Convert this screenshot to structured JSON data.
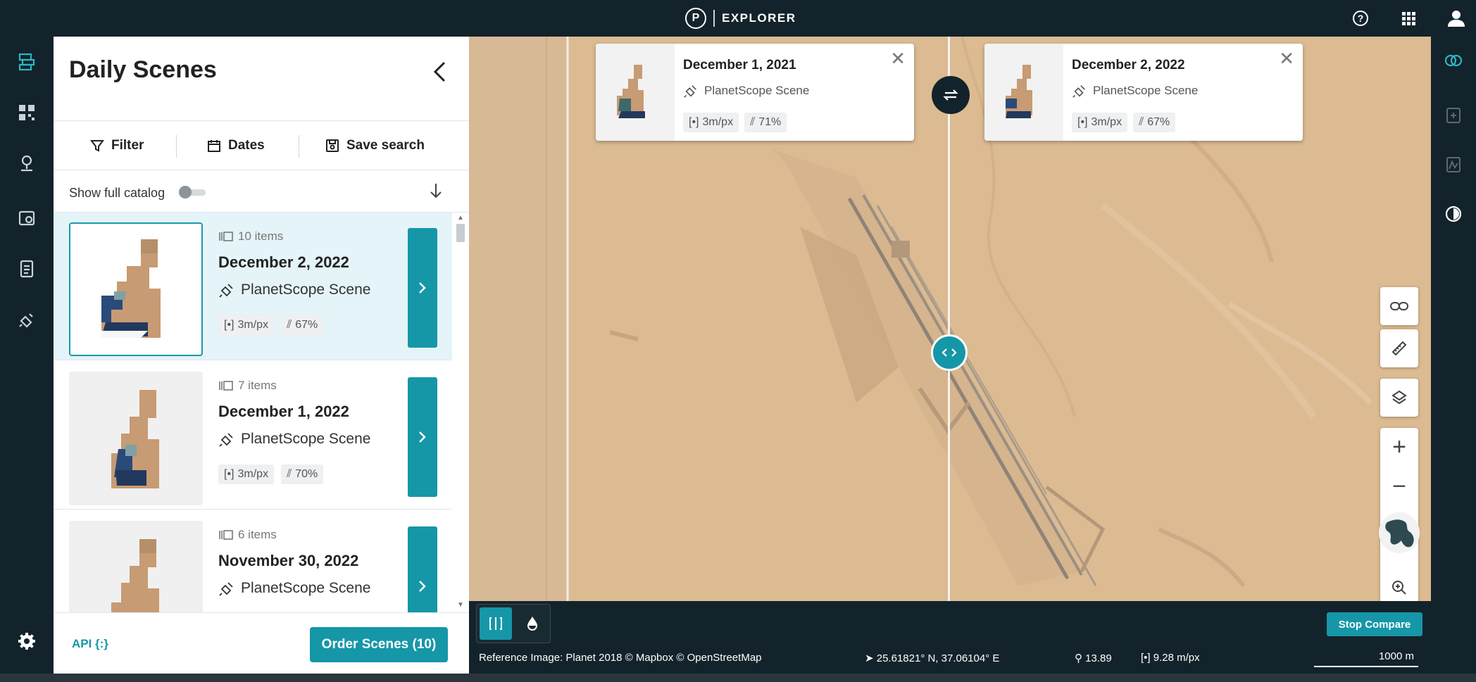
{
  "app": {
    "logo_letter": "P",
    "name": "EXPLORER"
  },
  "topbar": {
    "help_icon": "help-icon",
    "apps_icon": "apps-grid-icon",
    "user_icon": "user-icon"
  },
  "panel": {
    "title": "Daily Scenes",
    "toolbar": {
      "filter": "Filter",
      "dates": "Dates",
      "save_search": "Save search"
    },
    "show_full_catalog": "Show full catalog",
    "items": [
      {
        "count": "10 items",
        "date": "December 2, 2022",
        "satellite": "PlanetScope Scene",
        "resolution": "3m/px",
        "cloud": "67%",
        "selected": true
      },
      {
        "count": "7 items",
        "date": "December 1, 2022",
        "satellite": "PlanetScope Scene",
        "resolution": "3m/px",
        "cloud": "70%",
        "selected": false
      },
      {
        "count": "6 items",
        "date": "November 30, 2022",
        "satellite": "PlanetScope Scene",
        "resolution": "",
        "cloud": "",
        "selected": false
      }
    ],
    "footer": {
      "api_link": "API {:}",
      "order_button": "Order Scenes (10)"
    }
  },
  "compare": {
    "left": {
      "date": "December 1, 2021",
      "satellite": "PlanetScope Scene",
      "resolution": "3m/px",
      "cloud": "71%"
    },
    "right": {
      "date": "December 2, 2022",
      "satellite": "PlanetScope Scene",
      "resolution": "3m/px",
      "cloud": "67%"
    }
  },
  "bottom": {
    "stop_compare": "Stop Compare",
    "attribution": "Reference Image: Planet 2018 © Mapbox © OpenStreetMap",
    "coordinates": "25.61821° N, 37.06104° E",
    "zoom": "13.89",
    "pixel_size": "9.28 m/px",
    "scale": "1000 m"
  },
  "colors": {
    "accent": "#1597a8",
    "dark": "#13232b",
    "sand": "#d9b88f"
  }
}
